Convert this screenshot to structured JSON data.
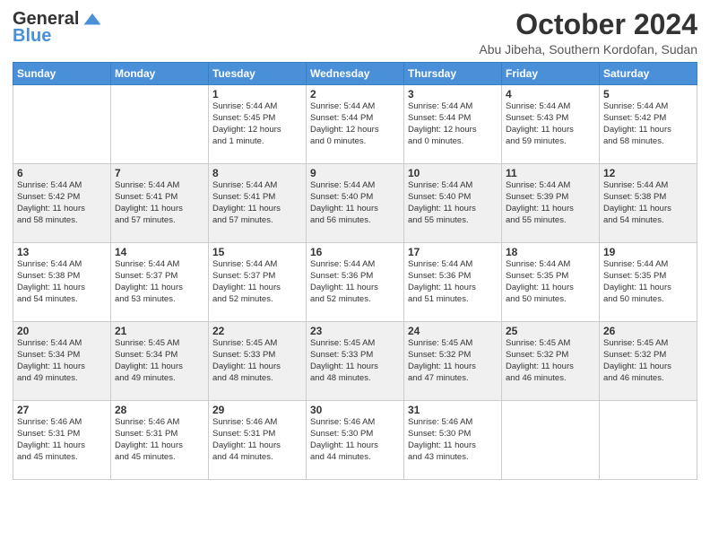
{
  "logo": {
    "general": "General",
    "blue": "Blue"
  },
  "title": "October 2024",
  "location": "Abu Jibeha, Southern Kordofan, Sudan",
  "days_of_week": [
    "Sunday",
    "Monday",
    "Tuesday",
    "Wednesday",
    "Thursday",
    "Friday",
    "Saturday"
  ],
  "weeks": [
    [
      {
        "day": "",
        "info": ""
      },
      {
        "day": "",
        "info": ""
      },
      {
        "day": "1",
        "info": "Sunrise: 5:44 AM\nSunset: 5:45 PM\nDaylight: 12 hours\nand 1 minute."
      },
      {
        "day": "2",
        "info": "Sunrise: 5:44 AM\nSunset: 5:44 PM\nDaylight: 12 hours\nand 0 minutes."
      },
      {
        "day": "3",
        "info": "Sunrise: 5:44 AM\nSunset: 5:44 PM\nDaylight: 12 hours\nand 0 minutes."
      },
      {
        "day": "4",
        "info": "Sunrise: 5:44 AM\nSunset: 5:43 PM\nDaylight: 11 hours\nand 59 minutes."
      },
      {
        "day": "5",
        "info": "Sunrise: 5:44 AM\nSunset: 5:42 PM\nDaylight: 11 hours\nand 58 minutes."
      }
    ],
    [
      {
        "day": "6",
        "info": "Sunrise: 5:44 AM\nSunset: 5:42 PM\nDaylight: 11 hours\nand 58 minutes."
      },
      {
        "day": "7",
        "info": "Sunrise: 5:44 AM\nSunset: 5:41 PM\nDaylight: 11 hours\nand 57 minutes."
      },
      {
        "day": "8",
        "info": "Sunrise: 5:44 AM\nSunset: 5:41 PM\nDaylight: 11 hours\nand 57 minutes."
      },
      {
        "day": "9",
        "info": "Sunrise: 5:44 AM\nSunset: 5:40 PM\nDaylight: 11 hours\nand 56 minutes."
      },
      {
        "day": "10",
        "info": "Sunrise: 5:44 AM\nSunset: 5:40 PM\nDaylight: 11 hours\nand 55 minutes."
      },
      {
        "day": "11",
        "info": "Sunrise: 5:44 AM\nSunset: 5:39 PM\nDaylight: 11 hours\nand 55 minutes."
      },
      {
        "day": "12",
        "info": "Sunrise: 5:44 AM\nSunset: 5:38 PM\nDaylight: 11 hours\nand 54 minutes."
      }
    ],
    [
      {
        "day": "13",
        "info": "Sunrise: 5:44 AM\nSunset: 5:38 PM\nDaylight: 11 hours\nand 54 minutes."
      },
      {
        "day": "14",
        "info": "Sunrise: 5:44 AM\nSunset: 5:37 PM\nDaylight: 11 hours\nand 53 minutes."
      },
      {
        "day": "15",
        "info": "Sunrise: 5:44 AM\nSunset: 5:37 PM\nDaylight: 11 hours\nand 52 minutes."
      },
      {
        "day": "16",
        "info": "Sunrise: 5:44 AM\nSunset: 5:36 PM\nDaylight: 11 hours\nand 52 minutes."
      },
      {
        "day": "17",
        "info": "Sunrise: 5:44 AM\nSunset: 5:36 PM\nDaylight: 11 hours\nand 51 minutes."
      },
      {
        "day": "18",
        "info": "Sunrise: 5:44 AM\nSunset: 5:35 PM\nDaylight: 11 hours\nand 50 minutes."
      },
      {
        "day": "19",
        "info": "Sunrise: 5:44 AM\nSunset: 5:35 PM\nDaylight: 11 hours\nand 50 minutes."
      }
    ],
    [
      {
        "day": "20",
        "info": "Sunrise: 5:44 AM\nSunset: 5:34 PM\nDaylight: 11 hours\nand 49 minutes."
      },
      {
        "day": "21",
        "info": "Sunrise: 5:45 AM\nSunset: 5:34 PM\nDaylight: 11 hours\nand 49 minutes."
      },
      {
        "day": "22",
        "info": "Sunrise: 5:45 AM\nSunset: 5:33 PM\nDaylight: 11 hours\nand 48 minutes."
      },
      {
        "day": "23",
        "info": "Sunrise: 5:45 AM\nSunset: 5:33 PM\nDaylight: 11 hours\nand 48 minutes."
      },
      {
        "day": "24",
        "info": "Sunrise: 5:45 AM\nSunset: 5:32 PM\nDaylight: 11 hours\nand 47 minutes."
      },
      {
        "day": "25",
        "info": "Sunrise: 5:45 AM\nSunset: 5:32 PM\nDaylight: 11 hours\nand 46 minutes."
      },
      {
        "day": "26",
        "info": "Sunrise: 5:45 AM\nSunset: 5:32 PM\nDaylight: 11 hours\nand 46 minutes."
      }
    ],
    [
      {
        "day": "27",
        "info": "Sunrise: 5:46 AM\nSunset: 5:31 PM\nDaylight: 11 hours\nand 45 minutes."
      },
      {
        "day": "28",
        "info": "Sunrise: 5:46 AM\nSunset: 5:31 PM\nDaylight: 11 hours\nand 45 minutes."
      },
      {
        "day": "29",
        "info": "Sunrise: 5:46 AM\nSunset: 5:31 PM\nDaylight: 11 hours\nand 44 minutes."
      },
      {
        "day": "30",
        "info": "Sunrise: 5:46 AM\nSunset: 5:30 PM\nDaylight: 11 hours\nand 44 minutes."
      },
      {
        "day": "31",
        "info": "Sunrise: 5:46 AM\nSunset: 5:30 PM\nDaylight: 11 hours\nand 43 minutes."
      },
      {
        "day": "",
        "info": ""
      },
      {
        "day": "",
        "info": ""
      }
    ]
  ]
}
